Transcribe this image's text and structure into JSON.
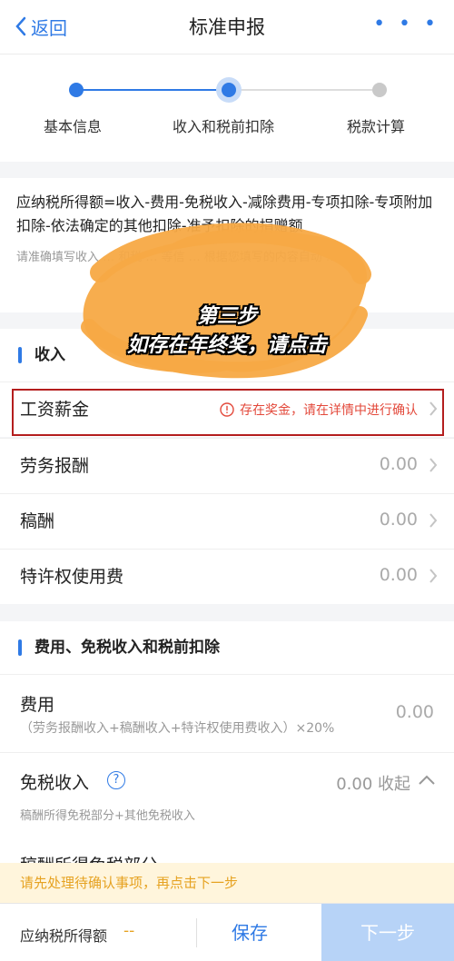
{
  "nav": {
    "back_label": "返回",
    "title": "标准申报",
    "more_label": "• • •"
  },
  "steps": [
    {
      "label": "基本信息",
      "state": "done"
    },
    {
      "label": "收入和税前扣除",
      "state": "current"
    },
    {
      "label": "税款计算",
      "state": "todo"
    }
  ],
  "formula": {
    "text": "应纳税所得额=收入-费用-免税收入-减除费用-专项扣除-专项附加扣除-依法确定的其他扣除-准予扣除的捐赠额",
    "hint": "请准确填写收入 … 和税 … 等信 … 根据您填写的内容自动 …"
  },
  "income_section": {
    "title": "收入",
    "rows": [
      {
        "name": "工资薪金",
        "warning": "存在奖金，请在详情中进行确认"
      },
      {
        "name": "劳务报酬",
        "value": "0.00"
      },
      {
        "name": "稿酬",
        "value": "0.00"
      },
      {
        "name": "特许权使用费",
        "value": "0.00"
      }
    ]
  },
  "deduction_section": {
    "title": "费用、免税收入和税前扣除",
    "fee": {
      "name": "费用",
      "sub": "（劳务报酬收入+稿酬收入+特许权使用费收入）×20%",
      "value": "0.00"
    },
    "exempt": {
      "name": "免税收入",
      "help": "?",
      "value": "0.00",
      "toggle": "收起",
      "sub": "稿酬所得免税部分+其他免税收入"
    },
    "cut_item": "稿酬所得免税部分"
  },
  "notice": "请先处理待确认事项，再点击下一步",
  "bottom": {
    "taxable_label": "应纳税所得额",
    "taxable_value": "--",
    "save_label": "保存",
    "next_label": "下一步"
  },
  "overlay": {
    "caption_line1": "第三步",
    "caption_line2": "如存在年终奖，请点击",
    "blob_color": "#f7a944"
  },
  "colors": {
    "accent": "#2f7ae5",
    "warning": "#e3493b",
    "notice": "#e6a221",
    "highlight_box": "#b41e1e"
  }
}
